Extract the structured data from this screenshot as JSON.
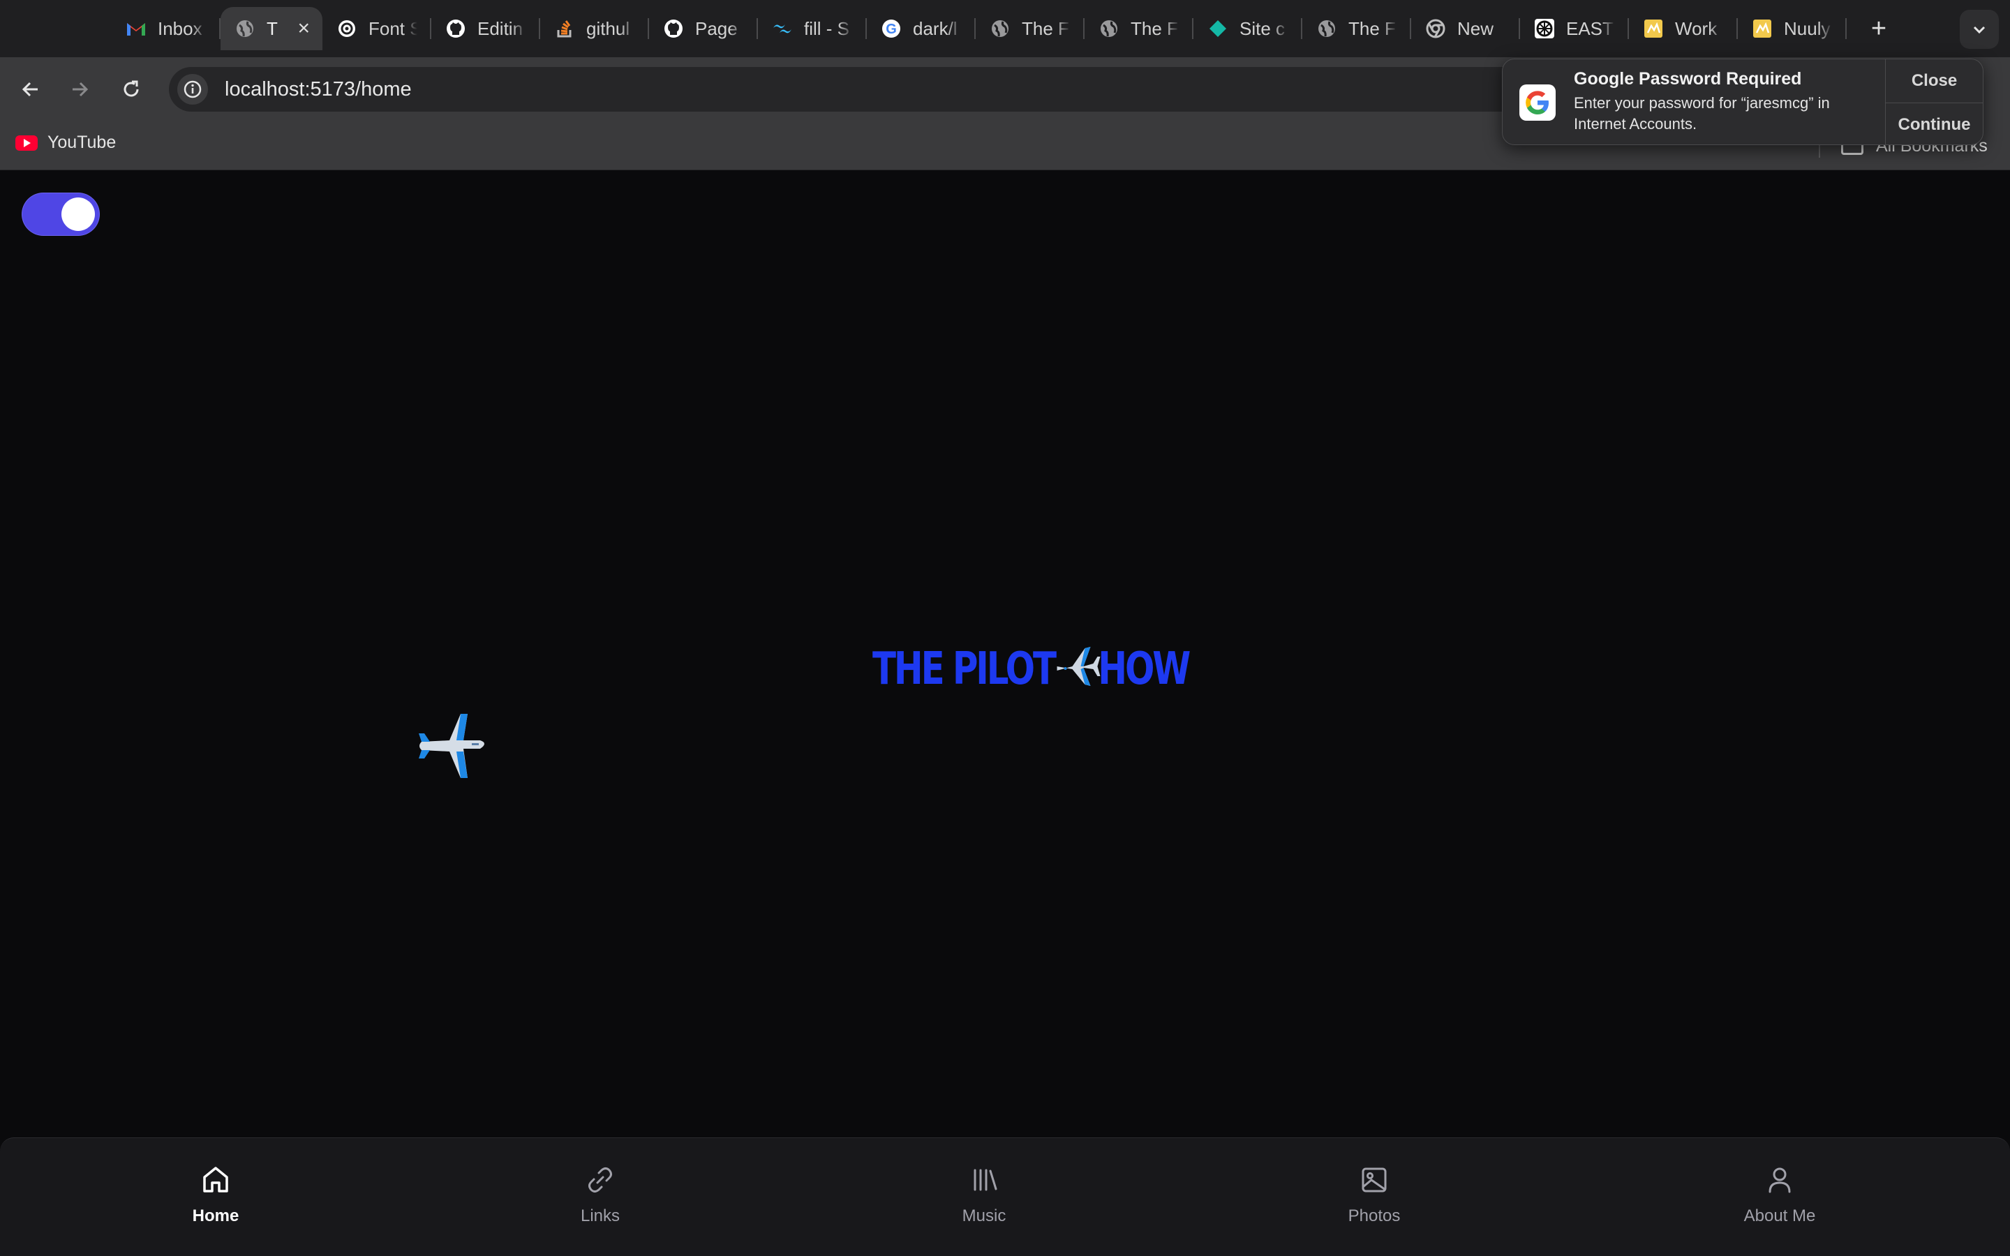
{
  "browser": {
    "tabs": [
      {
        "title": "Inbox",
        "icon": "gmail-icon",
        "active": false
      },
      {
        "title": "T",
        "icon": "globe-icon",
        "active": true
      },
      {
        "title": "Font S",
        "icon": "openai-icon",
        "active": false
      },
      {
        "title": "Editin",
        "icon": "github-icon",
        "active": false
      },
      {
        "title": "githul",
        "icon": "stackoverflow-icon",
        "active": false
      },
      {
        "title": "Page",
        "icon": "github-icon",
        "active": false
      },
      {
        "title": "fill - S",
        "icon": "tailwind-icon",
        "active": false
      },
      {
        "title": "dark/l",
        "icon": "google-icon",
        "active": false
      },
      {
        "title": "The F",
        "icon": "globe-icon",
        "active": false
      },
      {
        "title": "The F",
        "icon": "globe-icon",
        "active": false
      },
      {
        "title": "Site c",
        "icon": "diamond-icon",
        "active": false
      },
      {
        "title": "The F",
        "icon": "globe-icon",
        "active": false
      },
      {
        "title": "New",
        "icon": "chrome-icon",
        "active": false
      },
      {
        "title": "EAST",
        "icon": "east-logo-icon",
        "active": false
      },
      {
        "title": "Work",
        "icon": "workbook-icon",
        "active": false
      },
      {
        "title": "Nuuly",
        "icon": "workbook-icon",
        "active": false
      }
    ],
    "close_tab_glyph": "×",
    "new_tab_glyph": "+",
    "url": "localhost:5173/home",
    "bookmarks": [
      {
        "label": "YouTube",
        "icon": "youtube-icon"
      }
    ],
    "all_bookmarks_label": "All Bookmarks"
  },
  "notification": {
    "title": "Google Password Required",
    "body": "Enter your password for “jaresmcg” in Internet Accounts.",
    "close_label": "Close",
    "continue_label": "Continue"
  },
  "page": {
    "theme_toggle_on": true,
    "hero": {
      "text_left": "THE PILOT",
      "emoji": "✈️",
      "text_right": "HOW",
      "color": "#1d39f0"
    },
    "accent": "#4f46e5"
  },
  "bottom_nav": [
    {
      "label": "Home",
      "icon": "home-icon",
      "active": true
    },
    {
      "label": "Links",
      "icon": "link-icon",
      "active": false
    },
    {
      "label": "Music",
      "icon": "library-icon",
      "active": false
    },
    {
      "label": "Photos",
      "icon": "image-icon",
      "active": false
    },
    {
      "label": "About Me",
      "icon": "user-icon",
      "active": false
    }
  ]
}
